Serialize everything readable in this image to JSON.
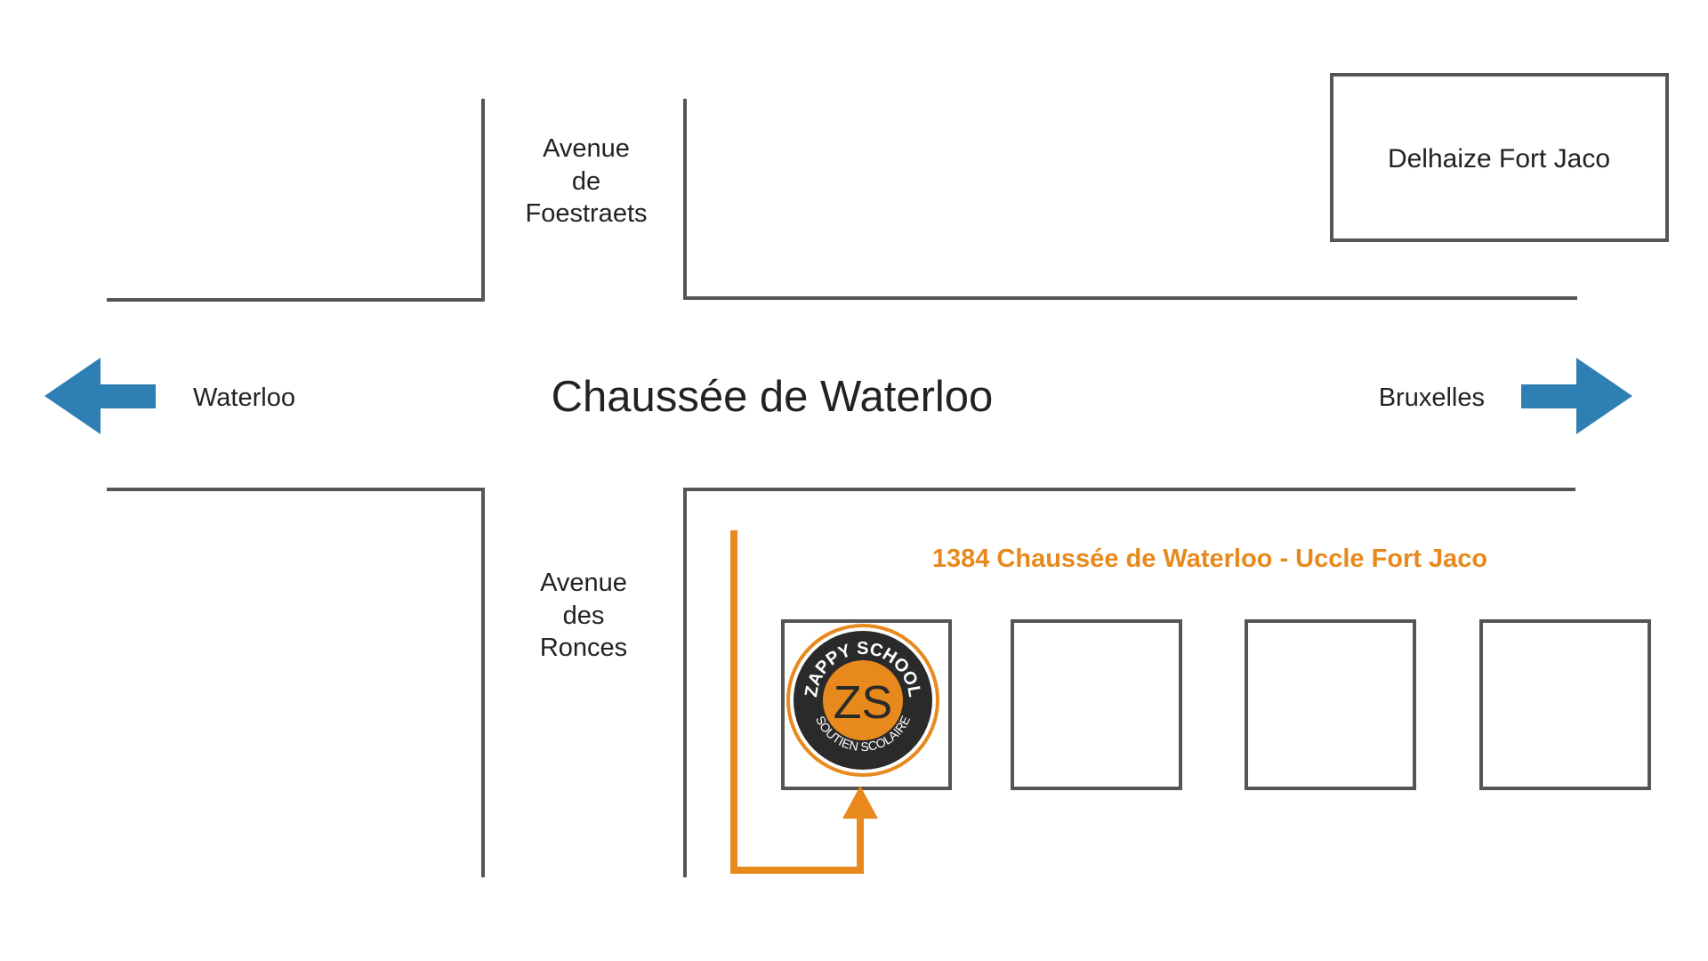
{
  "colors": {
    "street_line": "#555555",
    "text": "#222222",
    "direction_arrow": "#2e7fb3",
    "route": "#e8891d",
    "logo_dark": "#2a2a2a",
    "logo_orange": "#e8891d"
  },
  "labels": {
    "main_street": "Chaussée de Waterloo",
    "left_direction": "Waterloo",
    "right_direction": "Bruxelles",
    "avenue_north": [
      "Avenue",
      "de",
      "Foestraets"
    ],
    "avenue_south": [
      "Avenue",
      "des",
      "Ronces"
    ],
    "landmark": "Delhaize Fort Jaco",
    "address": "1384 Chaussée de Waterloo - Uccle Fort Jaco"
  },
  "logo": {
    "top_text": "ZAPPY SCHOOL",
    "bottom_text": "SOUTIEN SCOLAIRE",
    "monogram": "ZS"
  },
  "icons": {
    "left_arrow": "arrow-left-icon",
    "right_arrow": "arrow-right-icon",
    "route_arrow": "arrow-up-icon"
  }
}
